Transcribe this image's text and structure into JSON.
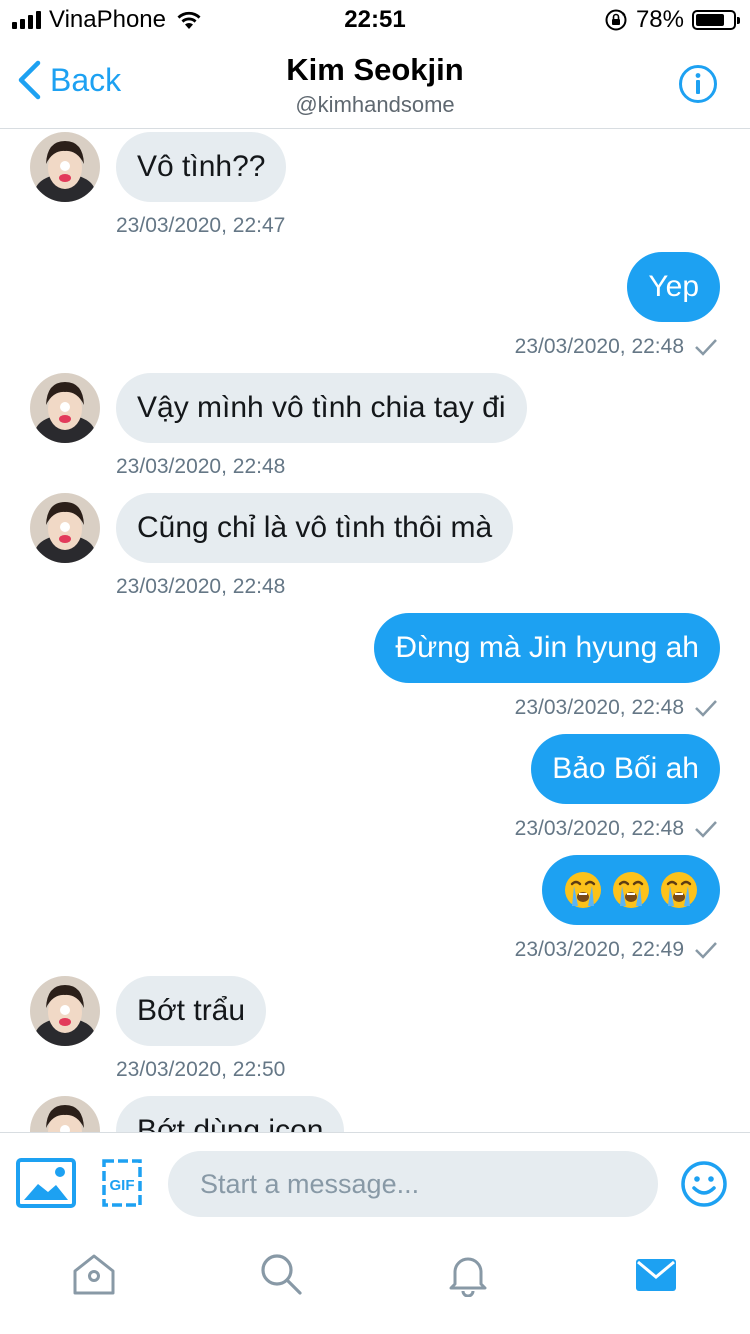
{
  "status_bar": {
    "carrier": "VinaPhone",
    "time": "22:51",
    "battery_percent": "78%",
    "battery_level": 0.78,
    "icons": [
      "signal-icon",
      "wifi-icon",
      "orientation-lock-icon",
      "battery-icon"
    ]
  },
  "header": {
    "back_label": "Back",
    "title": "Kim Seokjin",
    "handle": "@kimhandsome",
    "info_icon": "info-icon"
  },
  "messages": [
    {
      "dir": "in",
      "text": "Vô tình??",
      "time": "23/03/2020, 22:47"
    },
    {
      "dir": "out",
      "text": "Yep",
      "time": "23/03/2020, 22:48"
    },
    {
      "dir": "in",
      "text": "Vậy mình vô tình chia tay đi",
      "time": "23/03/2020, 22:48"
    },
    {
      "dir": "in",
      "text": "Cũng chỉ là vô tình thôi mà",
      "time": "23/03/2020, 22:48"
    },
    {
      "dir": "out",
      "text": "Đừng mà Jin hyung ah",
      "time": "23/03/2020, 22:48"
    },
    {
      "dir": "out",
      "text": "Bảo Bối ah",
      "time": "23/03/2020, 22:48"
    },
    {
      "dir": "out",
      "emoji": "crying-face",
      "count": 3,
      "time": "23/03/2020, 22:49"
    },
    {
      "dir": "in",
      "text": "Bớt trẩu",
      "time": "23/03/2020, 22:50"
    },
    {
      "dir": "in",
      "text": "Bớt dùng icon",
      "time": ""
    }
  ],
  "composer": {
    "placeholder": "Start a message...",
    "icons": [
      "image-icon",
      "gif-icon",
      "emoji-icon"
    ],
    "gif_label": "GIF"
  },
  "tab_bar": {
    "tabs": [
      "home-icon",
      "search-icon",
      "notifications-icon",
      "messages-icon"
    ],
    "active": "messages-icon"
  },
  "colors": {
    "accent": "#1da1f2",
    "incoming_bubble": "#e6ecf0",
    "timestamp": "#657786"
  }
}
